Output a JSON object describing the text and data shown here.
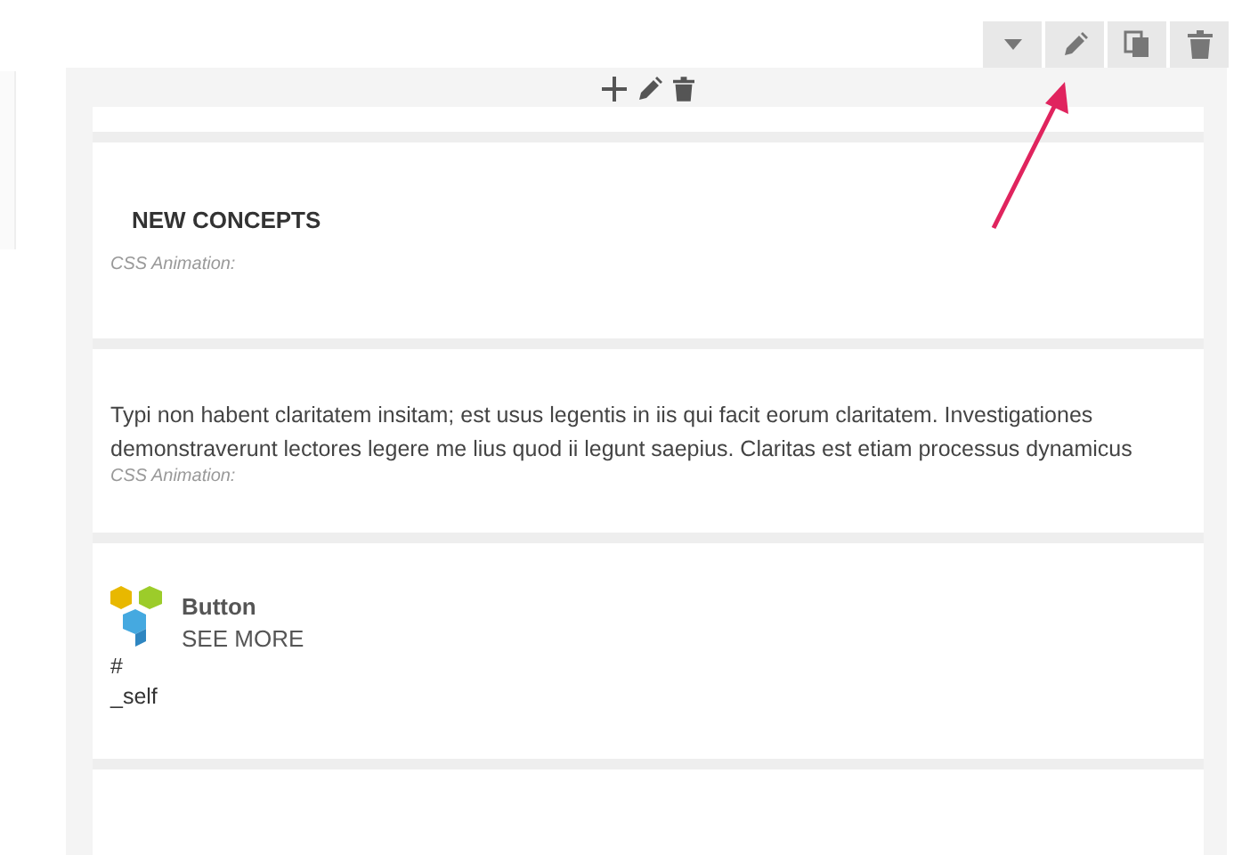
{
  "toolbar": [
    {
      "kind": "dropdown"
    },
    {
      "kind": "edit"
    },
    {
      "kind": "clone"
    },
    {
      "kind": "delete"
    }
  ],
  "column_controls": [
    {
      "kind": "add"
    },
    {
      "kind": "edit"
    },
    {
      "kind": "delete"
    }
  ],
  "elements": [
    {
      "kind": "heading",
      "title": "NEW CONCEPTS",
      "animation": "CSS Animation:"
    },
    {
      "kind": "text",
      "text": "Typi non habent claritatem insitam; est usus legentis in iis qui facit eorum claritatem. Investigationes demonstraverunt lectores legere me lius quod ii legunt saepius. Claritas est etiam processus dynamicus",
      "animation": "CSS Animation:"
    },
    {
      "kind": "button",
      "title": "Button",
      "label": "SEE MORE",
      "link": "#",
      "target": "_self"
    }
  ]
}
